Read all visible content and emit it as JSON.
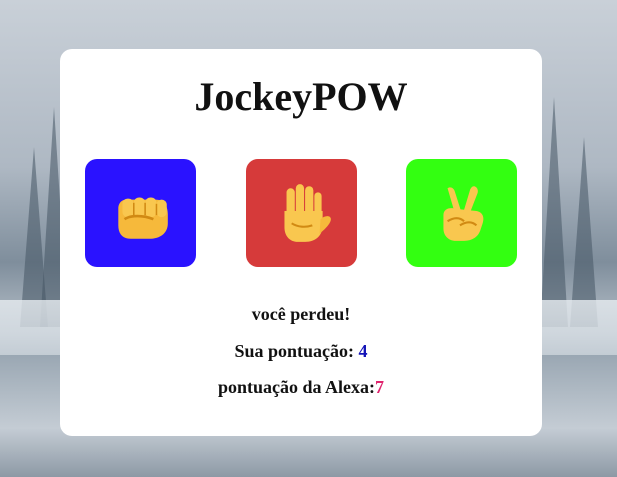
{
  "app": {
    "title": "JockeyPOW"
  },
  "choices": [
    {
      "name": "rock",
      "icon": "fist-icon",
      "color": "#2a12ff"
    },
    {
      "name": "paper",
      "icon": "raised-hand-icon",
      "color": "#d63a3a"
    },
    {
      "name": "scissors",
      "icon": "victory-hand-icon",
      "color": "#33ff11"
    }
  ],
  "result": {
    "message": "você perdeu!",
    "user_label": "Sua pontuação: ",
    "user_score": "4",
    "alexa_label": "pontuação da Alexa:",
    "alexa_score": "7"
  }
}
